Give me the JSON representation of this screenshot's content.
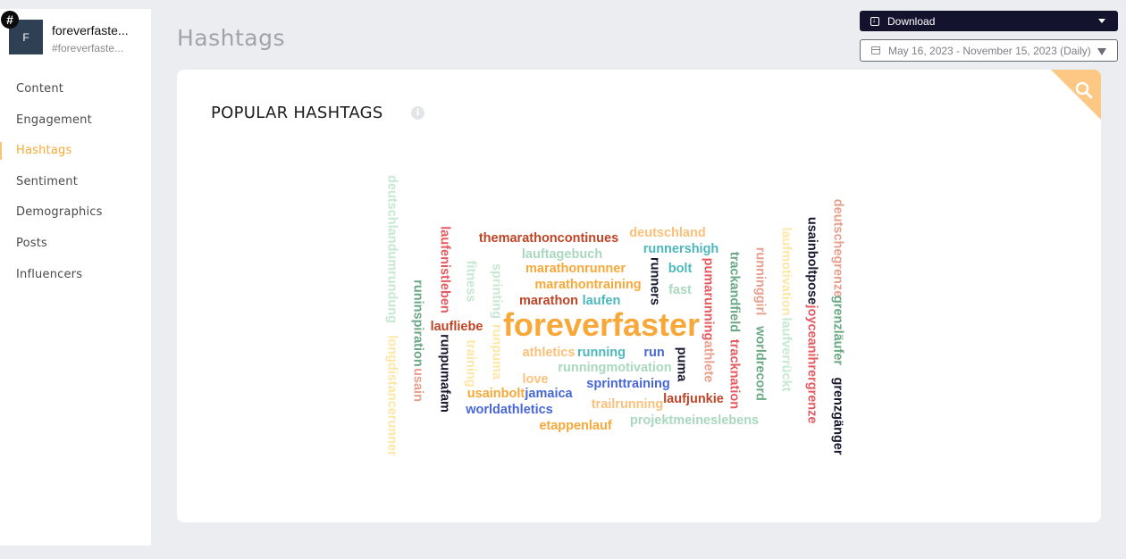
{
  "profile": {
    "avatar_letter": "F",
    "badge_symbol": "#",
    "name": "foreverfaste...",
    "handle": "#foreverfaste..."
  },
  "sidebar": {
    "active": "Hashtags",
    "items": [
      {
        "label": "Content"
      },
      {
        "label": "Engagement"
      },
      {
        "label": "Hashtags"
      },
      {
        "label": "Sentiment"
      },
      {
        "label": "Demographics"
      },
      {
        "label": "Posts"
      },
      {
        "label": "Influencers"
      }
    ]
  },
  "header": {
    "title": "Hashtags",
    "download_label": "Download",
    "download_icon": "download-icon",
    "date_range": "May 16, 2023 - November 15, 2023 (Daily)",
    "date_icon": "calendar-icon"
  },
  "card": {
    "title": "POPULAR HASHTAGS",
    "info_symbol": "i",
    "search_icon": "search-icon"
  },
  "colors": {
    "accent": "#f7a935",
    "orange": "#f8a838",
    "light_orange": "#fcc07a",
    "teal": "#4cb8bb",
    "light_green": "#a9d8bf",
    "pale_green": "#c6e8d3",
    "green": "#6aa884",
    "red": "#e35a60",
    "brown_red": "#bf4325",
    "salmon": "#e8a08e",
    "navy": "#17172e",
    "blue": "#4767d8",
    "pale_yellow": "#fde7a4"
  },
  "wordcloud": {
    "words": [
      {
        "text": "foreverfaster",
        "weight": 100,
        "color": "#f8a838",
        "orientation": "horizontal"
      },
      {
        "text": "themarathoncontinues",
        "weight": 20,
        "color": "#bf4325",
        "orientation": "horizontal"
      },
      {
        "text": "deutschland",
        "weight": 20,
        "color": "#fcc07a",
        "orientation": "horizontal"
      },
      {
        "text": "runnershigh",
        "weight": 20,
        "color": "#4cb8bb",
        "orientation": "horizontal"
      },
      {
        "text": "lauftagebuch",
        "weight": 20,
        "color": "#a9d8bf",
        "orientation": "horizontal"
      },
      {
        "text": "marathonrunner",
        "weight": 20,
        "color": "#f8a838",
        "orientation": "horizontal"
      },
      {
        "text": "bolt",
        "weight": 20,
        "color": "#4cb8bb",
        "orientation": "horizontal"
      },
      {
        "text": "marathontraining",
        "weight": 20,
        "color": "#f8a838",
        "orientation": "horizontal"
      },
      {
        "text": "fast",
        "weight": 20,
        "color": "#a9d8bf",
        "orientation": "horizontal"
      },
      {
        "text": "marathon",
        "weight": 20,
        "color": "#bf4325",
        "orientation": "horizontal"
      },
      {
        "text": "laufen",
        "weight": 20,
        "color": "#4cb8bb",
        "orientation": "horizontal"
      },
      {
        "text": "laufliebe",
        "weight": 20,
        "color": "#bf4325",
        "orientation": "horizontal"
      },
      {
        "text": "athletics",
        "weight": 20,
        "color": "#fcc07a",
        "orientation": "horizontal"
      },
      {
        "text": "running",
        "weight": 20,
        "color": "#4cb8bb",
        "orientation": "horizontal"
      },
      {
        "text": "run",
        "weight": 20,
        "color": "#4767d8",
        "orientation": "horizontal"
      },
      {
        "text": "runningmotivation",
        "weight": 20,
        "color": "#a9d8bf",
        "orientation": "horizontal"
      },
      {
        "text": "love",
        "weight": 20,
        "color": "#fcc07a",
        "orientation": "horizontal"
      },
      {
        "text": "sprinttraining",
        "weight": 20,
        "color": "#4767d8",
        "orientation": "horizontal"
      },
      {
        "text": "usainbolt",
        "weight": 20,
        "color": "#f8a838",
        "orientation": "horizontal"
      },
      {
        "text": "jamaica",
        "weight": 20,
        "color": "#4767d8",
        "orientation": "horizontal"
      },
      {
        "text": "laufjunkie",
        "weight": 20,
        "color": "#bf4325",
        "orientation": "horizontal"
      },
      {
        "text": "trailrunning",
        "weight": 20,
        "color": "#fcc07a",
        "orientation": "horizontal"
      },
      {
        "text": "worldathletics",
        "weight": 20,
        "color": "#4767d8",
        "orientation": "horizontal"
      },
      {
        "text": "projektmeineslebens",
        "weight": 20,
        "color": "#a9d8bf",
        "orientation": "horizontal"
      },
      {
        "text": "etappenlauf",
        "weight": 20,
        "color": "#f8a838",
        "orientation": "horizontal"
      },
      {
        "text": "deutschlandumrundung",
        "weight": 20,
        "color": "#c6e8d3",
        "orientation": "vertical"
      },
      {
        "text": "longdistancerunner",
        "weight": 20,
        "color": "#fde7a4",
        "orientation": "vertical"
      },
      {
        "text": "runinspiration",
        "weight": 20,
        "color": "#6aa884",
        "orientation": "vertical"
      },
      {
        "text": "usain",
        "weight": 20,
        "color": "#e8a08e",
        "orientation": "vertical"
      },
      {
        "text": "laufenistleben",
        "weight": 20,
        "color": "#e35a60",
        "orientation": "vertical"
      },
      {
        "text": "runpumafam",
        "weight": 20,
        "color": "#17172e",
        "orientation": "vertical"
      },
      {
        "text": "fitness",
        "weight": 20,
        "color": "#c6e8d3",
        "orientation": "vertical"
      },
      {
        "text": "training",
        "weight": 20,
        "color": "#fde7a4",
        "orientation": "vertical"
      },
      {
        "text": "sprinting",
        "weight": 20,
        "color": "#c6e8d3",
        "orientation": "vertical"
      },
      {
        "text": "runpuma",
        "weight": 20,
        "color": "#fde7a4",
        "orientation": "vertical"
      },
      {
        "text": "runners",
        "weight": 20,
        "color": "#17172e",
        "orientation": "vertical"
      },
      {
        "text": "puma",
        "weight": 20,
        "color": "#17172e",
        "orientation": "vertical"
      },
      {
        "text": "pumarunning",
        "weight": 20,
        "color": "#e35a60",
        "orientation": "vertical"
      },
      {
        "text": "athlete",
        "weight": 20,
        "color": "#e8a08e",
        "orientation": "vertical"
      },
      {
        "text": "trackandfield",
        "weight": 20,
        "color": "#6aa884",
        "orientation": "vertical"
      },
      {
        "text": "tracknation",
        "weight": 20,
        "color": "#e35a60",
        "orientation": "vertical"
      },
      {
        "text": "runninggirl",
        "weight": 20,
        "color": "#e8a08e",
        "orientation": "vertical"
      },
      {
        "text": "worldrecord",
        "weight": 20,
        "color": "#6aa884",
        "orientation": "vertical"
      },
      {
        "text": "laufmotivation",
        "weight": 20,
        "color": "#fde7a4",
        "orientation": "vertical"
      },
      {
        "text": "laufverrückt",
        "weight": 20,
        "color": "#c6e8d3",
        "orientation": "vertical"
      },
      {
        "text": "usainboltpose",
        "weight": 20,
        "color": "#17172e",
        "orientation": "vertical"
      },
      {
        "text": "joyceanihrergrenze",
        "weight": 20,
        "color": "#e35a60",
        "orientation": "vertical"
      },
      {
        "text": "deutschegrenze",
        "weight": 20,
        "color": "#e8a08e",
        "orientation": "vertical"
      },
      {
        "text": "grenzläufer",
        "weight": 20,
        "color": "#6aa884",
        "orientation": "vertical"
      },
      {
        "text": "grenzgänger",
        "weight": 20,
        "color": "#17172e",
        "orientation": "vertical"
      }
    ]
  }
}
